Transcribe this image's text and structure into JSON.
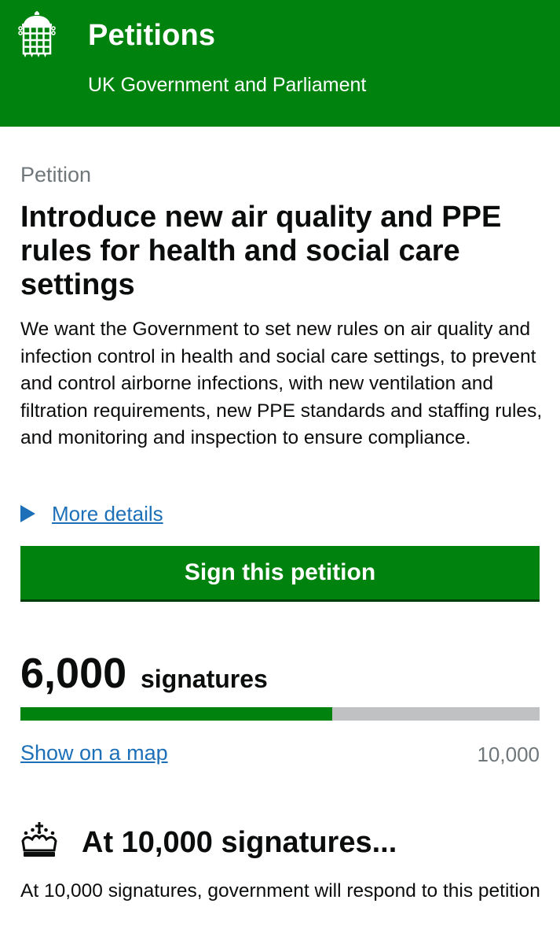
{
  "header": {
    "title": "Petitions",
    "subtitle": "UK Government and Parliament",
    "background_color": "#00830e",
    "logo_icon": "portcullis-icon"
  },
  "petition": {
    "caption": "Petition",
    "title": "Introduce new air quality and PPE rules for health and social care settings",
    "description": "We want the Government to set new rules on air quality and infection control in health and social care settings, to prevent and control airborne infections, with new ventilation and filtration requirements, new PPE standards and staffing rules, and monitoring and inspection to ensure compliance.",
    "more_details_label": "More details",
    "sign_button_label": "Sign this petition"
  },
  "signatures": {
    "count": "6,000",
    "label": "signatures",
    "progress_fraction": 0.6,
    "map_link_label": "Show on a map",
    "threshold": "10,000"
  },
  "milestone": {
    "icon": "crown-icon",
    "title": "At 10,000 signatures...",
    "description": "At 10,000 signatures, government will respond to this petition"
  },
  "colors": {
    "brand_green": "#00830e",
    "link_blue": "#1d70b8",
    "secondary_text": "#6f777b",
    "progress_track": "#bfc1c3"
  }
}
